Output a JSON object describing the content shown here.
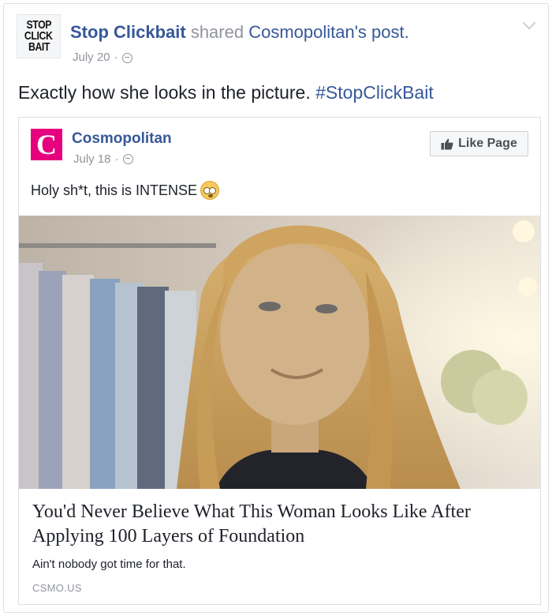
{
  "sharer": {
    "avatar_lines": [
      "STOP",
      "CLICK",
      "BAIT"
    ],
    "name": "Stop Clickbait",
    "action": "shared",
    "shared_from": "Cosmopolitan's post.",
    "date": "July 20",
    "separator": "·"
  },
  "status": {
    "text": "Exactly how she looks in the picture.",
    "hashtag": "#StopClickBait"
  },
  "original_post": {
    "page_logo_letter": "C",
    "page_name": "Cosmopolitan",
    "date": "July 18",
    "separator": "·",
    "like_button_label": "Like Page",
    "text": "Holy sh*t, this is INTENSE"
  },
  "link_preview": {
    "title": "You'd Never Believe What This Woman Looks Like After Applying 100 Layers of Foundation",
    "description": "Ain't nobody got time for that.",
    "domain": "CSMO.US"
  },
  "icons": {
    "privacy": "globe-icon",
    "menu": "chevron-down-icon",
    "like": "thumbs-up-icon",
    "emoji": "flushed-face-icon"
  },
  "colors": {
    "link_blue": "#365899",
    "meta_gray": "#90949c",
    "cosmo_pink": "#e6007e"
  }
}
